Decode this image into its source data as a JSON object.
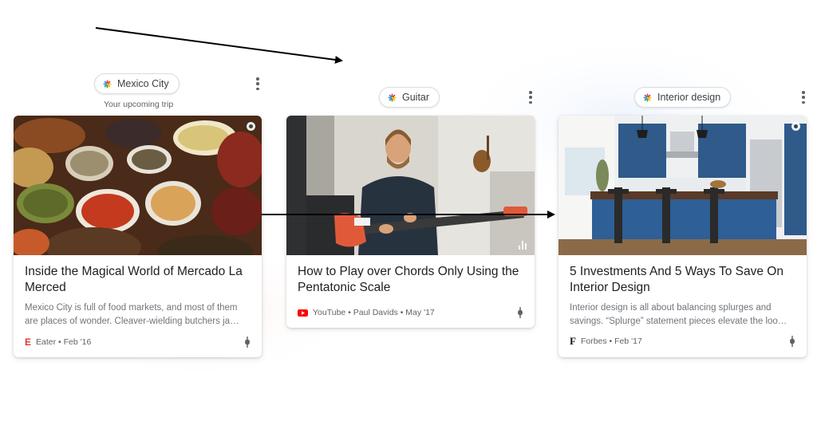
{
  "columns": [
    {
      "chip_label": "Mexico City",
      "chip_subtitle": "Your upcoming trip",
      "card": {
        "title": "Inside the Magical World of Mercado La Merced",
        "snippet": "Mexico City is full of food markets, and most of them are places of wonder. Cleaver-wielding butchers ja…",
        "source": "Eater • Feb '16",
        "source_logo": "E",
        "source_logo_color": "#e03a2e"
      }
    },
    {
      "chip_label": "Guitar",
      "card": {
        "title": "How to Play over Chords Only Using the Pentatonic Scale",
        "snippet": "",
        "source": "YouTube • Paul Davids • May '17",
        "source_logo": "youtube-icon",
        "source_logo_color": "#ff0000"
      }
    },
    {
      "chip_label": "Interior design",
      "card": {
        "title": "5 Investments And 5 Ways To Save On Interior Design",
        "snippet": "Interior design is all about balancing splurges and savings. “Splurge” statement pieces elevate the loo…",
        "source": "Forbes • Feb '17",
        "source_logo": "F",
        "source_logo_color": "#111111"
      }
    }
  ]
}
